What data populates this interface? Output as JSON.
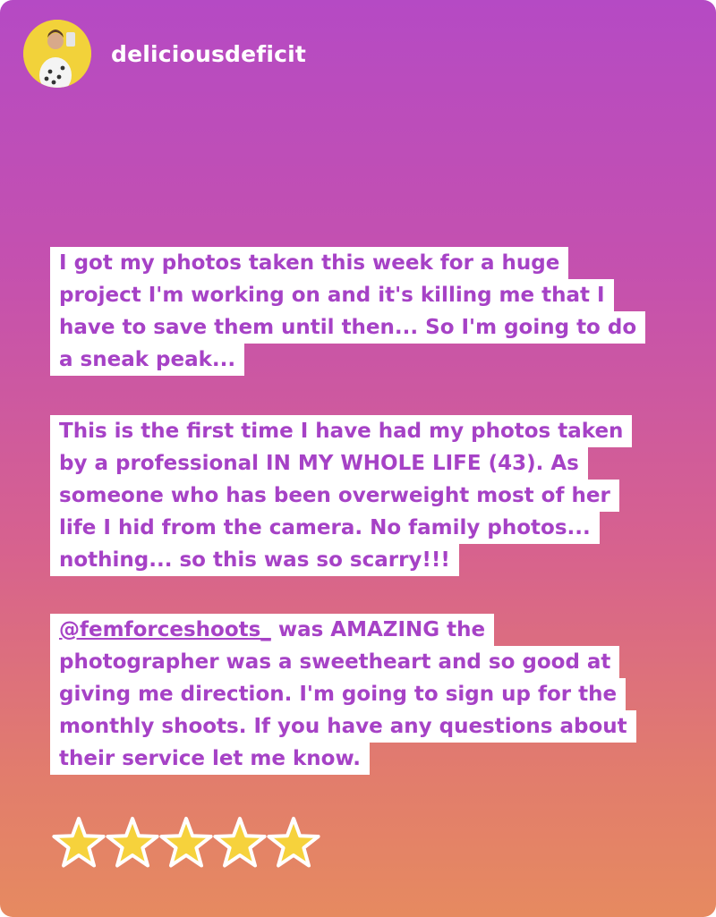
{
  "header": {
    "username": "deliciousdeficit",
    "avatar_icon": "profile-photo-avatar",
    "avatar_bg": "#f2d23a"
  },
  "paragraphs": {
    "p1": {
      "lines": [
        "I got my photos taken this week for a huge",
        "project I'm working on and it's killing me that I",
        "have to save them until then... So I'm going to do",
        "a sneak peak..."
      ]
    },
    "p2": {
      "lines": [
        "This is the first time I have had my photos taken",
        "by a professional IN MY WHOLE LIFE (43). As",
        "someone who has been overweight most of her",
        "life I hid from the camera. No family photos...",
        "nothing... so this was so scarry!!!"
      ]
    },
    "p3": {
      "mention": "@femforceshoots_",
      "line1_rest": " was AMAZING the",
      "lines": [
        "photographer was a sweetheart and so good at",
        "giving me direction. I'm going to sign up for the",
        "monthly shoots. If you have any questions about",
        "their service let me know."
      ]
    }
  },
  "rating": {
    "stars": 5,
    "max": 5,
    "star_icon": "star-sticker-icon",
    "star_color": "#f6d23c"
  },
  "colors": {
    "text_accent": "#a642c6",
    "gradient_top": "#b54ac4",
    "gradient_bottom": "#e68a60"
  }
}
